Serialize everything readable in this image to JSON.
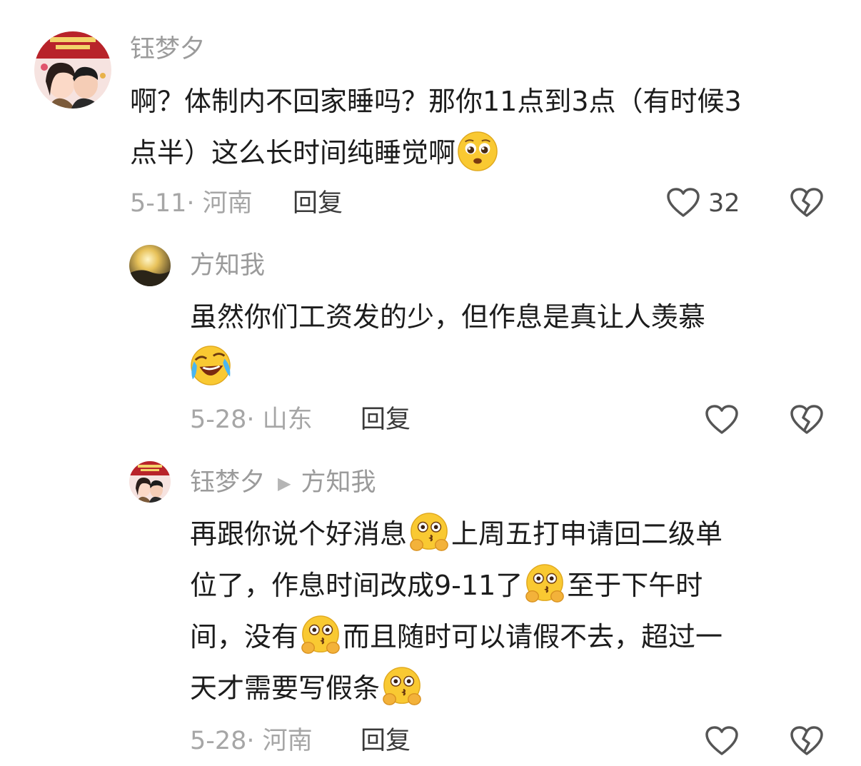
{
  "comments": [
    {
      "author": "钰梦夕",
      "text_lines": [
        "啊？体制内不回家睡吗？那你11点到3点（有时候3",
        "点半）这么长时间纯睡觉啊"
      ],
      "date_location": "5-11· 河南",
      "reply_label": "回复",
      "like_count": "32"
    },
    {
      "author": "方知我",
      "text_lines": [
        "虽然你们工资发的少，但作息是真让人羡慕"
      ],
      "date_location": "5-28· 山东",
      "reply_label": "回复"
    },
    {
      "author": "钰梦夕",
      "reply_to": "方知我",
      "text_segments": [
        "再跟你说个好消息",
        "上周五打申请回二级单",
        "位了，作息时间改成9-11了",
        "至于下午时",
        "间，没有",
        "而且随时可以请假不去，超过一",
        "天才需要写假条"
      ],
      "date_location": "5-28· 河南",
      "reply_label": "回复"
    }
  ],
  "icons": {
    "like": "heart-outline-icon",
    "dislike": "broken-heart-icon",
    "emoji_1": "pleading-face-emoji",
    "emoji_2": "laughing-crying-emoji",
    "emoji_3": "thinking-kiss-emoji"
  }
}
